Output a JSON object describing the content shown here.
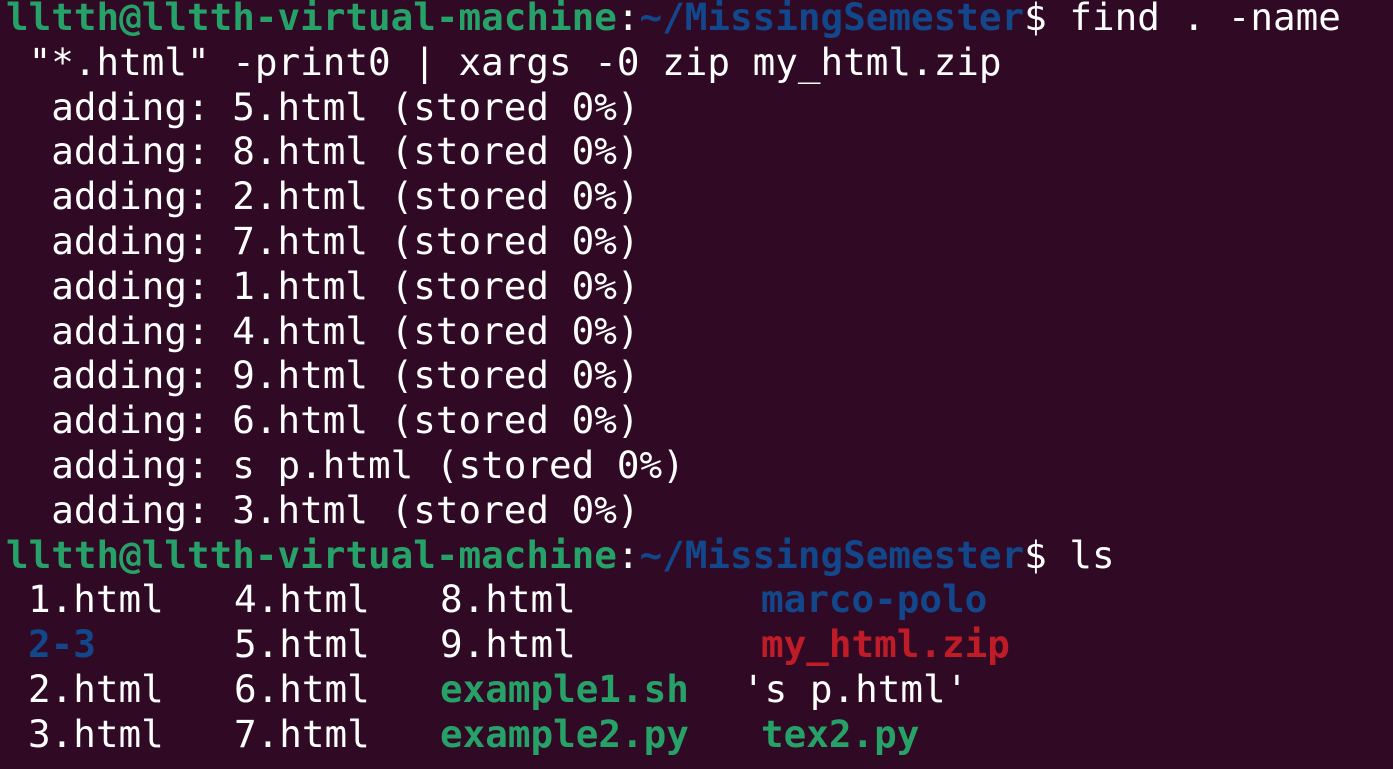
{
  "colors": {
    "background": "#300a24",
    "prompt_user": "#26a269",
    "prompt_path": "#12488b",
    "text": "#ffffff",
    "directory": "#12488b",
    "executable": "#26a269",
    "archive": "#c01c28"
  },
  "prompt": {
    "user_host": "lltth@lltth-virtual-machine",
    "colon": ":",
    "path": "~/MissingSemester",
    "symbol": "$"
  },
  "commands": {
    "find_cmd_part1": " find . -name",
    "find_cmd_part2": " \"*.html\" -print0 | xargs -0 zip my_html.zip",
    "ls_cmd": " ls"
  },
  "output_lines": [
    "  adding: 5.html (stored 0%)",
    "  adding: 8.html (stored 0%)",
    "  adding: 2.html (stored 0%)",
    "  adding: 7.html (stored 0%)",
    "  adding: 1.html (stored 0%)",
    "  adding: 4.html (stored 0%)",
    "  adding: 9.html (stored 0%)",
    "  adding: 6.html (stored 0%)",
    "  adding: s p.html (stored 0%)",
    "  adding: 3.html (stored 0%)"
  ],
  "ls_rows": [
    [
      "1.html",
      "4.html",
      "8.html",
      "marco-polo"
    ],
    [
      "2-3",
      "5.html",
      "9.html",
      "my_html.zip"
    ],
    [
      "2.html",
      "6.html",
      "example1.sh",
      "'s p.html'"
    ],
    [
      "3.html",
      "7.html",
      "example2.py",
      "tex2.py"
    ]
  ],
  "ls_types": [
    [
      "file",
      "file",
      "file",
      "dir"
    ],
    [
      "dir",
      "file",
      "file",
      "arch"
    ],
    [
      "file",
      "file",
      "exec",
      "file"
    ],
    [
      "file",
      "file",
      "exec",
      "exec"
    ]
  ]
}
